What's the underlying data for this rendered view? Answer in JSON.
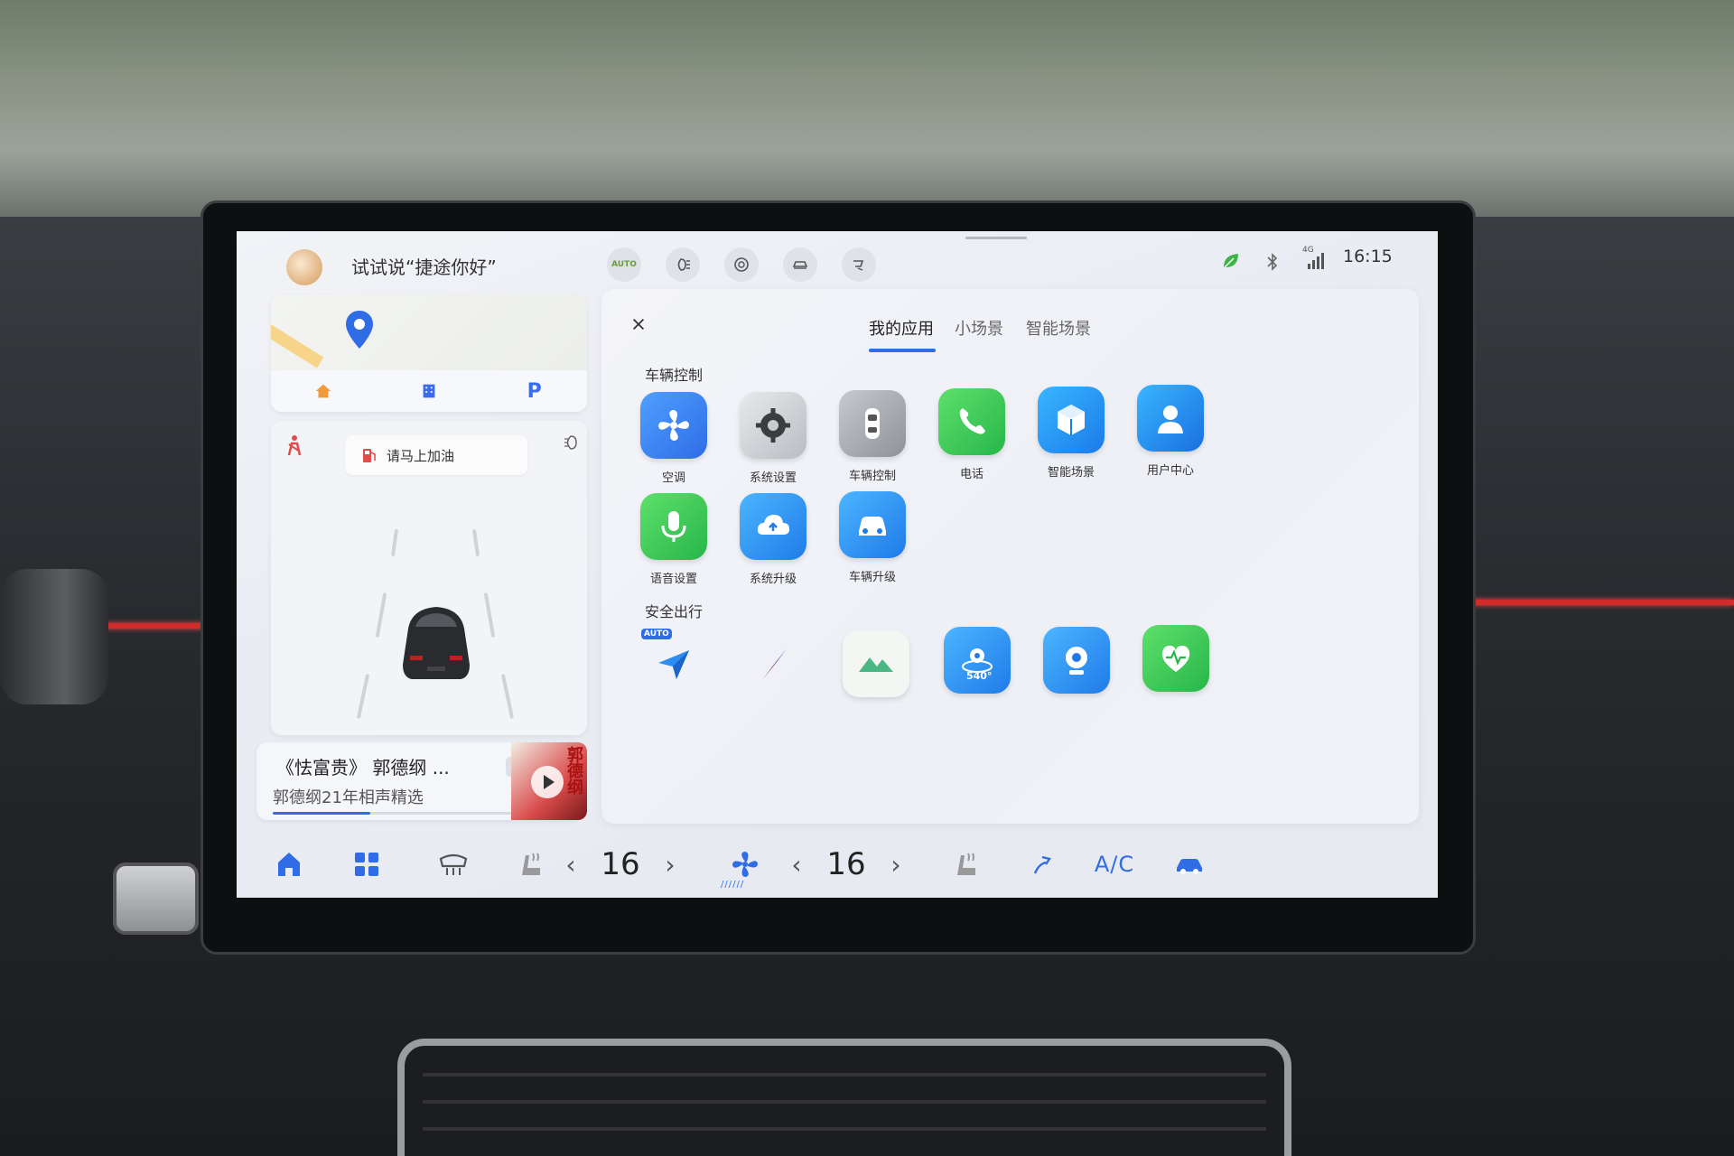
{
  "status_bar": {
    "voice_hint": "试试说“捷途你好”",
    "time": "16:15",
    "quick_icons": [
      "auto-headlight-icon",
      "fog-light-icon",
      "tire-pressure-icon",
      "car-trunk-icon",
      "seat-ventilation-icon"
    ],
    "quick_auto_label": "AUTO",
    "network_label": "4G"
  },
  "map_card": {
    "nav_items": [
      "home-icon",
      "company-icon",
      "parking-icon"
    ],
    "parking_label": "P"
  },
  "drive_card": {
    "fuel_reminder": "请马上加油"
  },
  "media_card": {
    "title": "《怯富贵》 郭德纲 ...",
    "subtitle": "郭德纲21年相声精选",
    "album_text": "郭德纲",
    "progress": 0.36
  },
  "app_panel": {
    "tabs": [
      {
        "label": "我的应用",
        "active": true
      },
      {
        "label": "小场景",
        "active": false
      },
      {
        "label": "智能场景",
        "active": false
      }
    ],
    "sections": [
      {
        "label": "车辆控制",
        "apps": [
          {
            "label": "空调",
            "icon": "fan-icon"
          },
          {
            "label": "系统设置",
            "icon": "gear-icon"
          },
          {
            "label": "车辆控制",
            "icon": "car-top-icon"
          },
          {
            "label": "电话",
            "icon": "phone-icon"
          },
          {
            "label": "智能场景",
            "icon": "cube-icon"
          },
          {
            "label": "用户中心",
            "icon": "user-icon"
          },
          {
            "label": "语音设置",
            "icon": "microphone-icon"
          },
          {
            "label": "系统升级",
            "icon": "cloud-upgrade-icon"
          },
          {
            "label": "车辆升级",
            "icon": "car-upgrade-icon"
          }
        ]
      },
      {
        "label": "安全出行",
        "apps": [
          {
            "label": "",
            "icon": "auto-navigation-icon",
            "badge": "AUTO"
          },
          {
            "label": "",
            "icon": "compass-icon"
          },
          {
            "label": "",
            "icon": "mountain-icon"
          },
          {
            "label": "",
            "icon": "camera-540-icon",
            "badge": "540°"
          },
          {
            "label": "",
            "icon": "webcam-icon"
          },
          {
            "label": "",
            "icon": "health-heart-icon"
          }
        ]
      }
    ]
  },
  "dock": {
    "driver_temp": "16",
    "passenger_temp": "16",
    "ac_label": "A/C",
    "prev_symbol": "‹",
    "next_symbol": "›"
  },
  "colors": {
    "accent": "#2f6ce6",
    "screen_bg": "#eef0f5",
    "dash_red": "#d22b2b"
  }
}
